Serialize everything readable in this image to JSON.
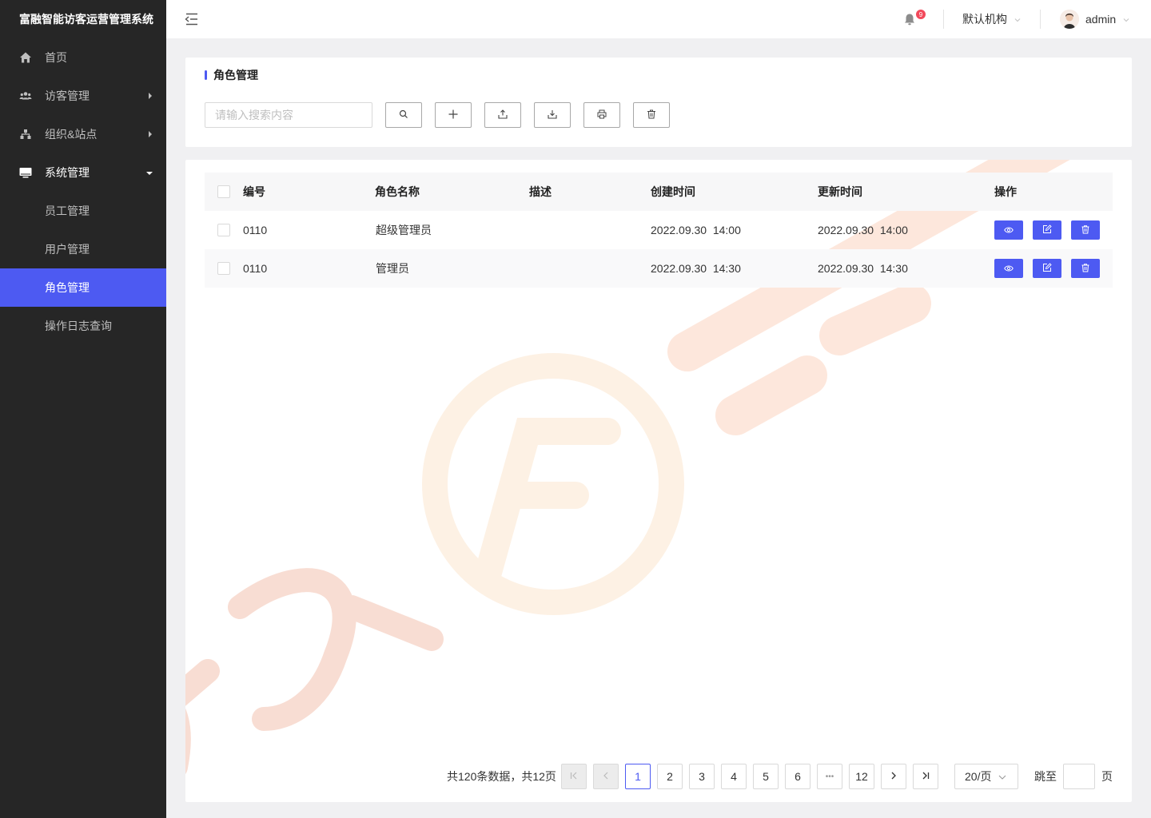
{
  "app": {
    "title": "富融智能访客运营管理系统"
  },
  "sidebar": {
    "items": [
      {
        "label": "首页",
        "icon": "home-icon"
      },
      {
        "label": "访客管理",
        "icon": "users-icon"
      },
      {
        "label": "组织&站点",
        "icon": "org-tree-icon"
      },
      {
        "label": "系统管理",
        "icon": "monitor-icon"
      },
      {
        "label": "员工管理"
      },
      {
        "label": "用户管理"
      },
      {
        "label": "角色管理"
      },
      {
        "label": "操作日志查询"
      }
    ]
  },
  "header": {
    "notification_count": "9",
    "org": "默认机构",
    "user": "admin"
  },
  "page": {
    "title": "角色管理",
    "search_placeholder": "请输入搜索内容"
  },
  "table": {
    "columns": [
      "编号",
      "角色名称",
      "描述",
      "创建时间",
      "更新时间",
      "操作"
    ],
    "rows": [
      {
        "id": "0110",
        "name": "超级管理员",
        "desc": "",
        "created": "2022.09.30  14:00",
        "updated": "2022.09.30  14:00"
      },
      {
        "id": "0110",
        "name": "管理员",
        "desc": "",
        "created": "2022.09.30  14:30",
        "updated": "2022.09.30  14:30"
      }
    ]
  },
  "pagination": {
    "summary": "共120条数据，共12页",
    "pages": [
      "1",
      "2",
      "3",
      "4",
      "5",
      "6",
      "•••",
      "12"
    ],
    "current": "1",
    "page_size": "20/页",
    "jump_label": "跳至",
    "jump_suffix": "页"
  },
  "colors": {
    "accent": "#4d5af2",
    "sidebar_bg": "#262626",
    "badge": "#f2495b"
  }
}
